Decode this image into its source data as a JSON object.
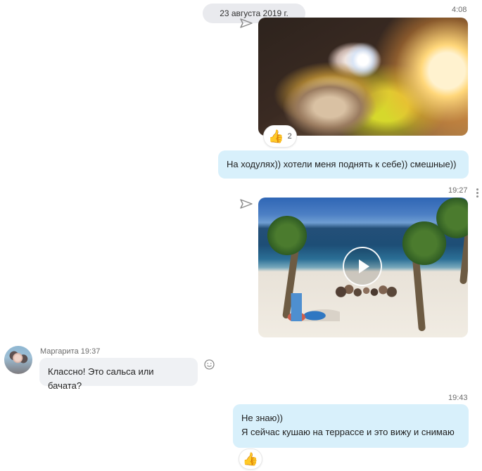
{
  "chat": {
    "date_separator": "23 августа 2019 г.",
    "messages": [
      {
        "time": "4:08",
        "media_type": "photo",
        "reaction": {
          "emoji": "👍",
          "count": "2"
        }
      },
      {
        "text": "На ходулях)) хотели меня поднять к себе)) смешные))"
      },
      {
        "time": "19:27",
        "media_type": "video"
      },
      {
        "sender": "Маргарита",
        "time": "19:37",
        "text": "Классно! Это сальса или бачата?"
      },
      {
        "time": "19:43",
        "line1": "Не знаю))",
        "line2": "Я сейчас кушаю на террассе и это вижу и снимаю",
        "reaction": {
          "emoji": "👍"
        }
      }
    ]
  },
  "icons": {
    "sent": "paper-plane-icon",
    "play": "play-icon",
    "more": "more-icon",
    "emoji": "emoji-icon",
    "thumbs_up": "thumbs-up-icon"
  },
  "colors": {
    "outgoing_bubble": "#d8f0fb",
    "incoming_bubble": "#eff1f4",
    "date_pill": "#e9eaee",
    "secondary_text": "#6b6b6b"
  }
}
